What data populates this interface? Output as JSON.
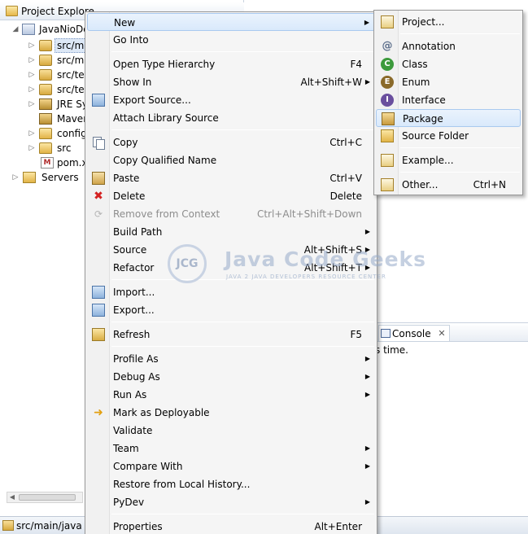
{
  "explorer": {
    "title": "Project Explore",
    "tree": [
      {
        "label": "JavaNioDo",
        "kind": "project"
      },
      {
        "label": "src/ma",
        "kind": "pkgfolder",
        "selected": true
      },
      {
        "label": "src/ma",
        "kind": "pkgfolder"
      },
      {
        "label": "src/tes",
        "kind": "pkgfolder"
      },
      {
        "label": "src/tes",
        "kind": "pkgfolder"
      },
      {
        "label": "JRE Sy",
        "kind": "jar"
      },
      {
        "label": "Maver",
        "kind": "jar"
      },
      {
        "label": "config",
        "kind": "folder"
      },
      {
        "label": "src",
        "kind": "folder"
      },
      {
        "label": "pom.x",
        "kind": "pom",
        "pom_glyph": "M"
      },
      {
        "label": "Servers",
        "kind": "server"
      }
    ]
  },
  "status_bar": {
    "text": "src/main/java -"
  },
  "console": {
    "tab_label": "Console",
    "close_glyph": "✕",
    "body_text": "s time."
  },
  "watermark": {
    "badge": "JCG",
    "title": "Java Code Geeks",
    "subtitle": "JAVA 2 JAVA DEVELOPERS RESOURCE CENTER"
  },
  "context_menu": {
    "items": [
      {
        "label": "New",
        "submenu": true,
        "highlighted": true
      },
      {
        "label": "Go Into"
      },
      {
        "separator": true
      },
      {
        "label": "Open Type Hierarchy",
        "shortcut": "F4"
      },
      {
        "label": "Show In",
        "shortcut": "Alt+Shift+W",
        "submenu": true
      },
      {
        "label": "Export Source...",
        "icon": "export-source-icon"
      },
      {
        "label": "Attach Library Source"
      },
      {
        "separator": true
      },
      {
        "label": "Copy",
        "shortcut": "Ctrl+C",
        "icon": "copy-icon"
      },
      {
        "label": "Copy Qualified Name"
      },
      {
        "label": "Paste",
        "shortcut": "Ctrl+V",
        "icon": "paste-icon"
      },
      {
        "label": "Delete",
        "shortcut": "Delete",
        "icon": "delete-icon"
      },
      {
        "label": "Remove from Context",
        "shortcut": "Ctrl+Alt+Shift+Down",
        "disabled": true,
        "icon": "remove-context-icon"
      },
      {
        "label": "Build Path",
        "submenu": true
      },
      {
        "label": "Source",
        "shortcut": "Alt+Shift+S",
        "submenu": true
      },
      {
        "label": "Refactor",
        "shortcut": "Alt+Shift+T",
        "submenu": true
      },
      {
        "separator": true
      },
      {
        "label": "Import...",
        "icon": "import-icon"
      },
      {
        "label": "Export...",
        "icon": "export-icon"
      },
      {
        "separator": true
      },
      {
        "label": "Refresh",
        "shortcut": "F5",
        "icon": "refresh-icon"
      },
      {
        "separator": true
      },
      {
        "label": "Profile As",
        "submenu": true
      },
      {
        "label": "Debug As",
        "submenu": true
      },
      {
        "label": "Run As",
        "submenu": true
      },
      {
        "label": "Mark as Deployable",
        "icon": "deploy-icon"
      },
      {
        "label": "Validate"
      },
      {
        "label": "Team",
        "submenu": true
      },
      {
        "label": "Compare With",
        "submenu": true
      },
      {
        "label": "Restore from Local History..."
      },
      {
        "label": "PyDev",
        "submenu": true
      },
      {
        "separator": true
      },
      {
        "label": "Properties",
        "shortcut": "Alt+Enter"
      }
    ]
  },
  "new_submenu": {
    "items": [
      {
        "label": "Project...",
        "icon": "new-project-icon"
      },
      {
        "separator": true
      },
      {
        "label": "Annotation",
        "icon": "annotation-icon",
        "glyph": "@"
      },
      {
        "label": "Class",
        "icon": "class-icon",
        "glyph": "C"
      },
      {
        "label": "Enum",
        "icon": "enum-icon",
        "glyph": "E"
      },
      {
        "label": "Interface",
        "icon": "interface-icon",
        "glyph": "I"
      },
      {
        "label": "Package",
        "icon": "package-icon",
        "highlighted": true
      },
      {
        "label": "Source Folder",
        "icon": "source-folder-icon"
      },
      {
        "separator": true
      },
      {
        "label": "Example...",
        "icon": "example-icon"
      },
      {
        "separator": true
      },
      {
        "label": "Other...",
        "shortcut": "Ctrl+N",
        "icon": "other-icon"
      }
    ]
  },
  "glyphs": {
    "submenu_arrow": "▶",
    "expand_arrow": "▷",
    "expanded_arrow": "◢",
    "delete_x": "✖",
    "deploy_arrow": "➜",
    "remove_glyph": "⟳"
  }
}
